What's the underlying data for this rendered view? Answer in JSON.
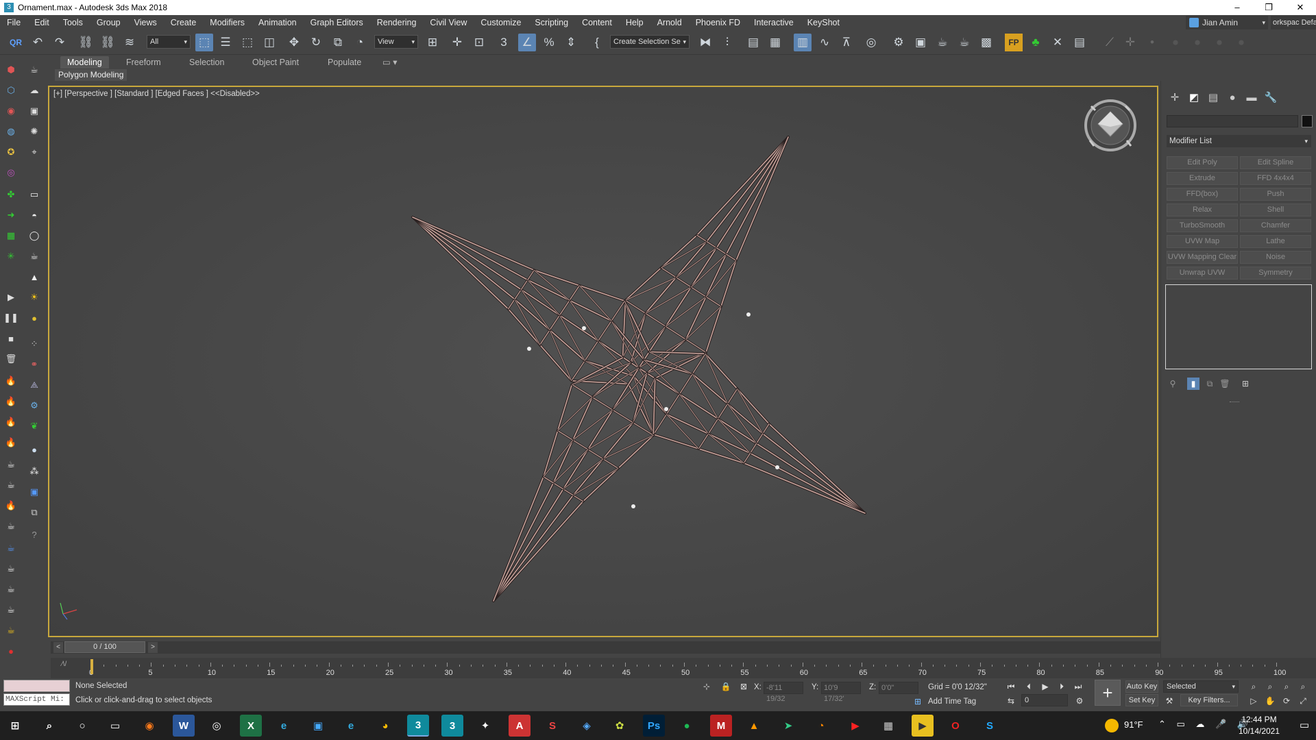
{
  "window": {
    "title": "Ornament.max - Autodesk 3ds Max 2018",
    "minimize": "–",
    "maximize": "❐",
    "close": "✕"
  },
  "menu": [
    "File",
    "Edit",
    "Tools",
    "Group",
    "Views",
    "Create",
    "Modifiers",
    "Animation",
    "Graph Editors",
    "Rendering",
    "Civil View",
    "Customize",
    "Scripting",
    "Content",
    "Help",
    "Arnold",
    "Phoenix FD",
    "Interactive",
    "KeyShot"
  ],
  "user": {
    "name": "Jian Amin",
    "workspace": "orkspac Defa"
  },
  "toolbar": {
    "selection_filter": "All",
    "ref_coord": "View",
    "named_selection": "Create Selection Se"
  },
  "ribbon": {
    "tabs": [
      "Modeling",
      "Freeform",
      "Selection",
      "Object Paint",
      "Populate"
    ],
    "active_tab": "Modeling",
    "panel": "Polygon Modeling"
  },
  "viewport": {
    "label": "[+] [Perspective ] [Standard ] [Edged Faces ]  <<Disabled>>"
  },
  "command_panel": {
    "modifier_list": "Modifier List",
    "modifiers": [
      [
        "Edit Poly",
        "Edit Spline"
      ],
      [
        "Extrude",
        "FFD 4x4x4"
      ],
      [
        "FFD(box)",
        "Push"
      ],
      [
        "Relax",
        "Shell"
      ],
      [
        "TurboSmooth",
        "Chamfer"
      ],
      [
        "UVW Map",
        "Lathe"
      ],
      [
        "UVW Mapping Clear",
        "Noise"
      ],
      [
        "Unwrap UVW",
        "Symmetry"
      ]
    ]
  },
  "timeline": {
    "slider": "0 / 100",
    "ticks": [
      "0",
      "5",
      "10",
      "15",
      "20",
      "25",
      "30",
      "35",
      "40",
      "45",
      "50",
      "55",
      "60",
      "65",
      "70",
      "75",
      "80",
      "85",
      "90",
      "95",
      "100"
    ]
  },
  "status": {
    "maxscript": "MAXScript Mi:",
    "selection": "None Selected",
    "prompt": "Click or click-and-drag to select objects",
    "x_label": "X:",
    "x_value": "-8'11 19/32",
    "y_label": "Y:",
    "y_value": "10'9 17/32'",
    "z_label": "Z:",
    "z_value": "0'0\"",
    "grid": "Grid = 0'0 12/32\"",
    "add_time_tag": "Add Time Tag",
    "auto_key": "Auto Key",
    "set_key": "Set Key",
    "selected": "Selected",
    "key_filters": "Key Filters...",
    "frame": "0"
  },
  "taskbar": {
    "weather": "91°F",
    "time": "12:44 PM",
    "date": "10/14/2021"
  },
  "colors": {
    "viewport_border": "#c8a83c",
    "active_tool": "#5b84b3",
    "wire_light": "#c7a39b",
    "wire_dark": "#2a2020"
  }
}
